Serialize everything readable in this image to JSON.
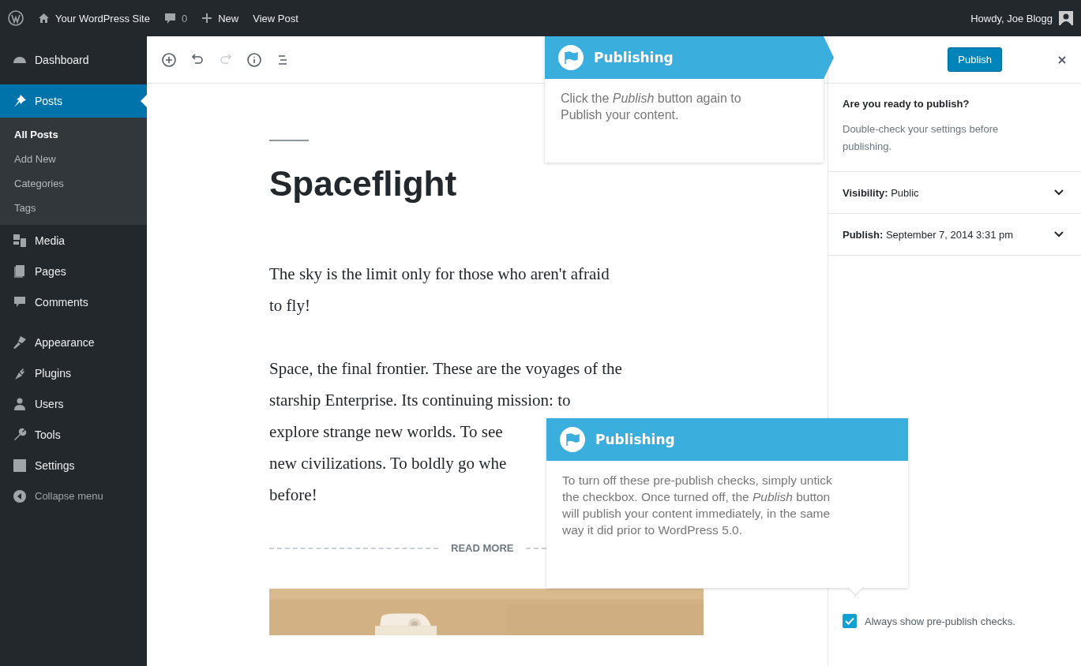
{
  "admin_bar": {
    "items": [
      {
        "kind": "logo"
      },
      {
        "kind": "home",
        "label": "Your WordPress Site"
      },
      {
        "kind": "comments",
        "label": "0"
      },
      {
        "kind": "new",
        "label": "New"
      },
      {
        "kind": "text",
        "label": "View Post"
      }
    ],
    "account": "Howdy, Joe Blogg"
  },
  "sidebar": {
    "groups": [
      [
        {
          "kind": "dashboard",
          "label": "Dashboard",
          "selected": false
        }
      ],
      [
        {
          "kind": "pin",
          "label": "Posts",
          "selected": true,
          "children": [
            {
              "label": "All Posts",
              "selected": true
            },
            {
              "label": "Add New",
              "selected": false
            },
            {
              "label": "Categories",
              "selected": false
            },
            {
              "label": "Tags",
              "selected": false
            }
          ]
        },
        {
          "kind": "media",
          "label": "Media",
          "selected": false
        },
        {
          "kind": "pages",
          "label": "Pages",
          "selected": false
        },
        {
          "kind": "comments",
          "label": "Comments",
          "selected": false
        }
      ],
      [
        {
          "kind": "brush",
          "label": "Appearance",
          "selected": false
        },
        {
          "kind": "plug",
          "label": "Plugins",
          "selected": false
        },
        {
          "kind": "user",
          "label": "Users",
          "selected": false
        },
        {
          "kind": "wrench",
          "label": "Tools",
          "selected": false
        },
        {
          "kind": "settings",
          "label": "Settings",
          "selected": false
        }
      ]
    ],
    "collapse": "Collapse menu"
  },
  "toolbar": [
    {
      "kind": "add",
      "disabled": false
    },
    {
      "kind": "undo",
      "disabled": false
    },
    {
      "kind": "redo",
      "disabled": true
    },
    {
      "kind": "info",
      "disabled": false
    },
    {
      "kind": "outline",
      "disabled": false
    }
  ],
  "post": {
    "title": "Spaceflight",
    "paragraphs": [
      {
        "lines": [
          "The sky is the limit only for those who aren't afraid",
          "to fly!"
        ]
      },
      {
        "lines": [
          "Space, the final frontier. These are the voyages of the",
          "starship Enterprise. Its  continuing mission: to",
          "explore strange new worlds. To see",
          "new civilizations. To boldly go whe",
          "before!"
        ]
      }
    ],
    "read_more": "READ MORE"
  },
  "publish_panel": {
    "button": "Publish",
    "heading": "Are you ready to publish?",
    "description": "Double-check your settings before publishing.",
    "rows": [
      {
        "label": "Visibility:",
        "value": "Public",
        "expanded": false
      },
      {
        "label": "Publish:",
        "value": "September 7, 2014 3:31 pm",
        "expanded": false
      }
    ],
    "checkbox": {
      "label": "Always show pre-publish checks.",
      "checked": true
    }
  },
  "tooltips": [
    {
      "title": "Publishing",
      "body": "Click the *Publish* button again to Publish your content.",
      "kind": "pointer_right"
    },
    {
      "title": "Publishing",
      "body": "To turn off these pre-publish checks, simply untick the checkbox. Once turned off, the *Publish* button will publish your content immediately, in the same way it did prior to WordPress 5.0.",
      "kind": "pointer_down"
    }
  ]
}
